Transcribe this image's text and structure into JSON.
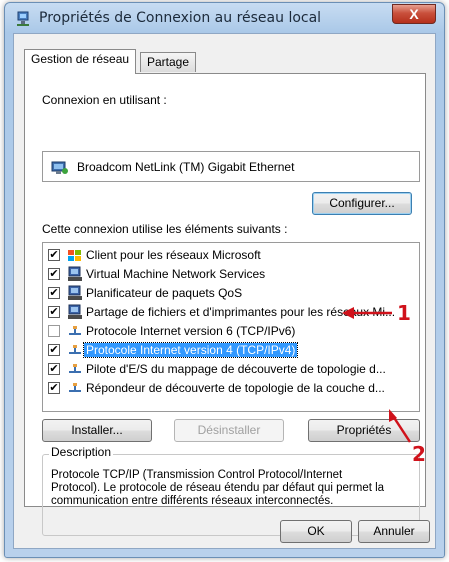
{
  "window": {
    "title": "Propriétés de Connexion au réseau local",
    "close_label": "X"
  },
  "tabs": [
    {
      "label": "Gestion de réseau",
      "active": true
    },
    {
      "label": "Partage",
      "active": false
    }
  ],
  "connect_using": {
    "label": "Connexion en utilisant :",
    "adapter": "Broadcom NetLink (TM) Gigabit Ethernet"
  },
  "configure_button": "Configurer...",
  "items_label": "Cette connexion utilise les éléments suivants :",
  "items": [
    {
      "label": "Client pour les réseaux Microsoft",
      "checked": true,
      "icon": "network-client-icon"
    },
    {
      "label": "Virtual Machine Network Services",
      "checked": true,
      "icon": "network-service-icon"
    },
    {
      "label": "Planificateur de paquets QoS",
      "checked": true,
      "icon": "network-service-icon"
    },
    {
      "label": "Partage de fichiers et d'imprimantes pour les réseaux Mi...",
      "checked": true,
      "icon": "network-service-icon"
    },
    {
      "label": "Protocole Internet version 6 (TCP/IPv6)",
      "checked": false,
      "icon": "protocol-icon"
    },
    {
      "label": "Protocole Internet version 4 (TCP/IPv4)",
      "checked": true,
      "icon": "protocol-icon",
      "selected": true
    },
    {
      "label": "Pilote d'E/S du mappage de découverte de topologie d...",
      "checked": true,
      "icon": "protocol-icon"
    },
    {
      "label": "Répondeur de découverte de topologie de la couche d...",
      "checked": true,
      "icon": "protocol-icon"
    }
  ],
  "buttons": {
    "install": "Installer...",
    "uninstall": "Désinstaller",
    "properties": "Propriétés"
  },
  "description": {
    "legend": "Description",
    "text": "Protocole TCP/IP (Transmission Control Protocol/Internet Protocol). Le protocole de réseau étendu par défaut qui permet la communication entre différents réseaux interconnectés."
  },
  "dialog_buttons": {
    "ok": "OK",
    "cancel": "Annuler"
  },
  "annotations": {
    "one": "1",
    "two": "2",
    "color": "#d0121b"
  },
  "colors": {
    "selection": "#3399ff",
    "title_bar": "#b9d1ec"
  }
}
